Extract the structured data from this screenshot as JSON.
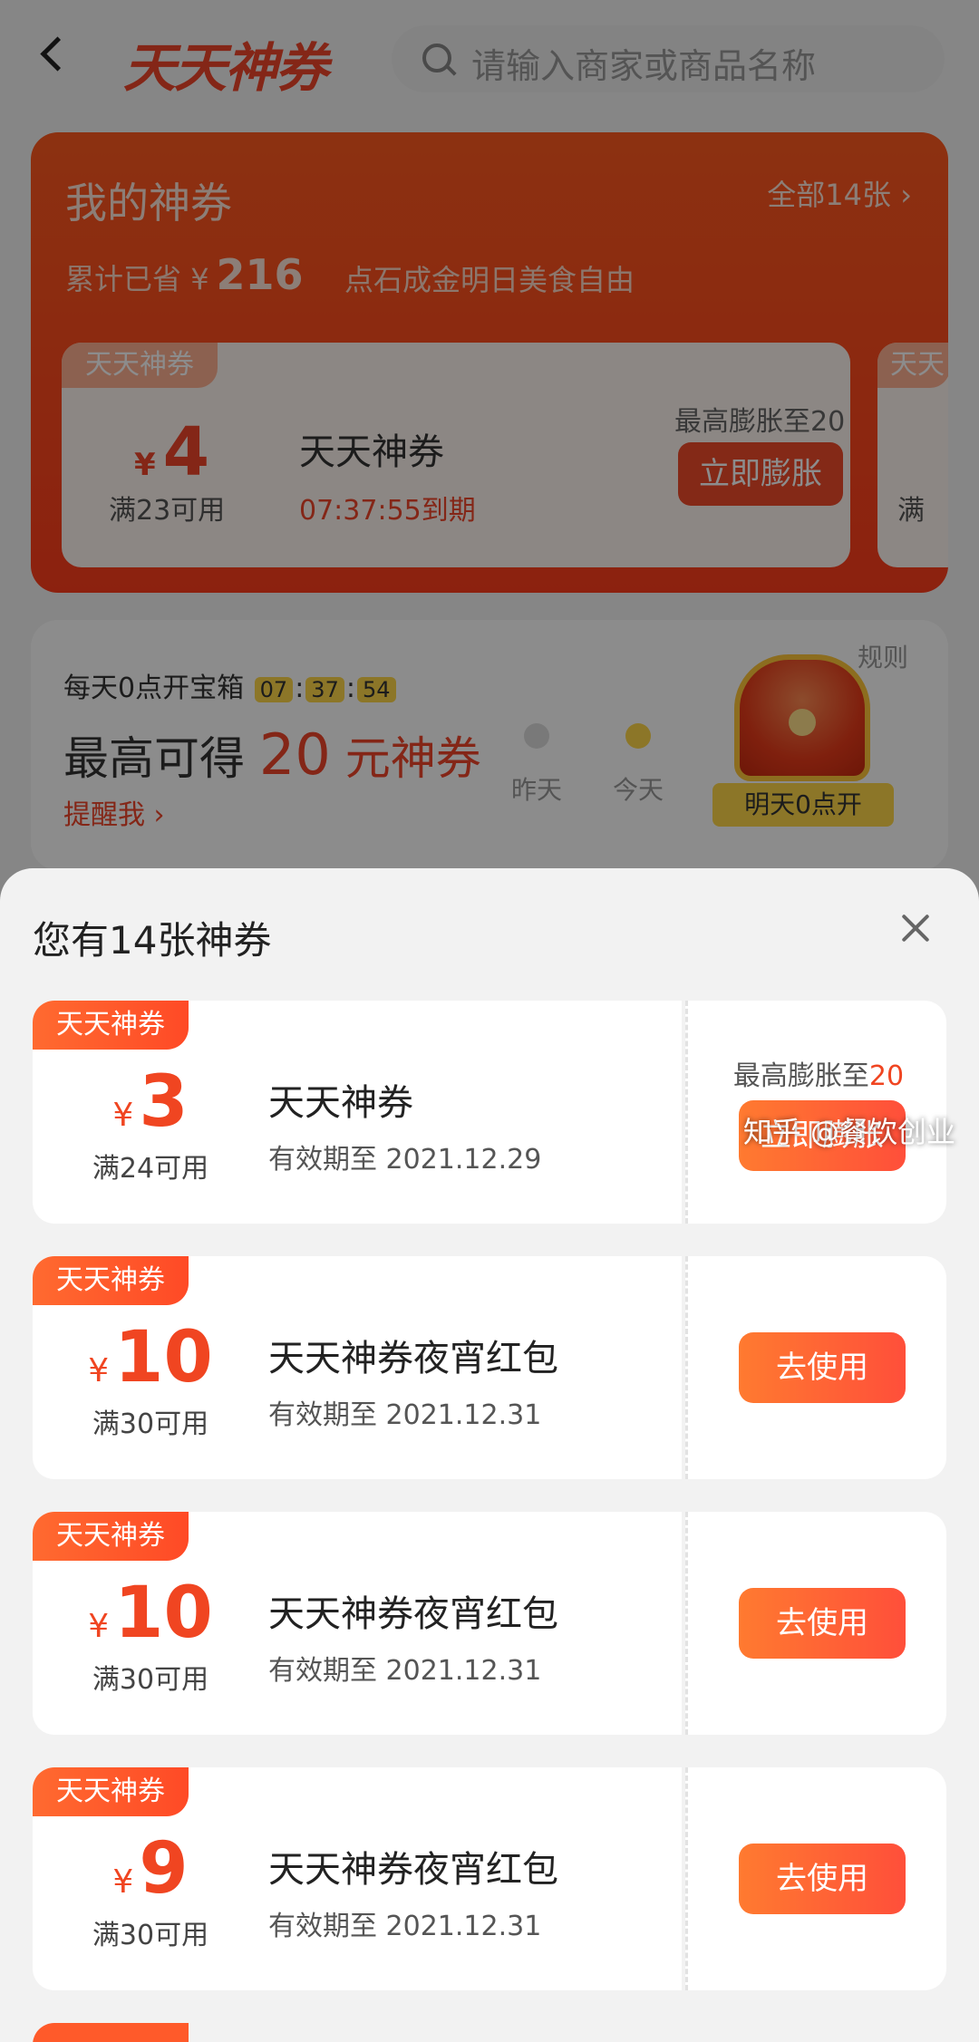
{
  "header": {
    "logo_text": "天天神券",
    "search_placeholder": "请输入商家或商品名称"
  },
  "my_coupons": {
    "title": "我的神券",
    "all_link": "全部14张 ›",
    "saved_label": "累计已省",
    "saved_currency": "¥",
    "saved_amount": "216",
    "slogan": "点石成金明日美食自由",
    "top_coupon": {
      "tag": "天天神券",
      "currency": "¥",
      "amount": "4",
      "condition": "满23可用",
      "name": "天天神券",
      "expire": "07:37:55到期",
      "right_label": "最高膨胀至20",
      "button": "立即膨胀"
    },
    "peek_coupon": {
      "tag": "天天",
      "condition": "满"
    }
  },
  "treasure": {
    "title": "每天0点开宝箱",
    "timer_h": "07",
    "timer_m": "37",
    "timer_s": "54",
    "headline_prefix": "最高可得",
    "headline_amount": "20",
    "headline_suffix": "元神券",
    "remind": "提醒我 ›",
    "rule": "规则",
    "day_yesterday": "昨天",
    "day_today": "今天",
    "chest_label": "明天0点开"
  },
  "sheet": {
    "title": "您有14张神券",
    "coupons": [
      {
        "tag": "天天神券",
        "currency": "¥",
        "amount": "3",
        "condition": "满24可用",
        "name": "天天神券",
        "expire": "有效期至 2021.12.29",
        "right_label_prefix": "最高膨胀至",
        "right_label_value": "20",
        "button": "立即膨胀"
      },
      {
        "tag": "天天神券",
        "currency": "¥",
        "amount": "10",
        "condition": "满30可用",
        "name": "天天神券夜宵红包",
        "expire": "有效期至 2021.12.31",
        "button": "去使用"
      },
      {
        "tag": "天天神券",
        "currency": "¥",
        "amount": "10",
        "condition": "满30可用",
        "name": "天天神券夜宵红包",
        "expire": "有效期至 2021.12.31",
        "button": "去使用"
      },
      {
        "tag": "天天神券",
        "currency": "¥",
        "amount": "9",
        "condition": "满30可用",
        "name": "天天神券夜宵红包",
        "expire": "有效期至 2021.12.31",
        "button": "去使用"
      }
    ]
  },
  "watermark": "知乎 @餐饮创业",
  "colors": {
    "accent": "#f04521",
    "header_card": "#ff4a1e",
    "timer_bg": "#ffd84a"
  }
}
